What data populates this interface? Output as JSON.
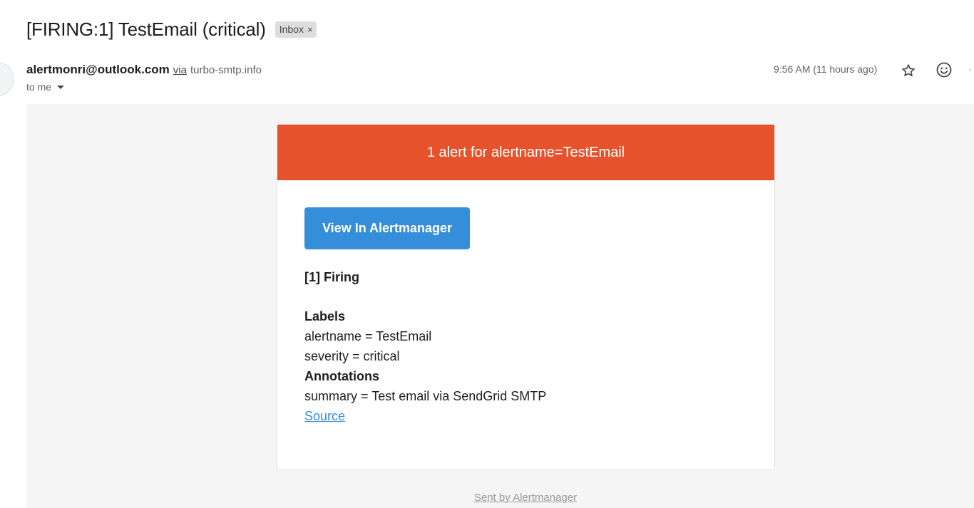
{
  "subject": "[FIRING:1] TestEmail (critical)",
  "label_chip": {
    "text": "Inbox",
    "close": "×"
  },
  "sender": {
    "email": "alertmonri@outlook.com",
    "via": "via",
    "via_domain": "turbo-smtp.info",
    "to": "to me"
  },
  "timestamp": "9:56 AM (11 hours ago)",
  "icons": {
    "star": "star-icon",
    "emoji": "emoji-icon",
    "more": "more-icon",
    "caret": "chevron-down-icon"
  },
  "alert": {
    "header": "1 alert for alertname=TestEmail",
    "button_label": "View In Alertmanager",
    "firing": "[1] Firing",
    "labels_title": "Labels",
    "labels": [
      "alertname = TestEmail",
      "severity = critical"
    ],
    "annotations_title": "Annotations",
    "annotations": [
      "summary = Test email via SendGrid SMTP"
    ],
    "source_link": "Source",
    "footer": "Sent by Alertmanager"
  },
  "colors": {
    "header_bg": "#e6522c",
    "button_bg": "#348eda",
    "body_bg": "#f5f5f5",
    "link": "#348eda"
  }
}
